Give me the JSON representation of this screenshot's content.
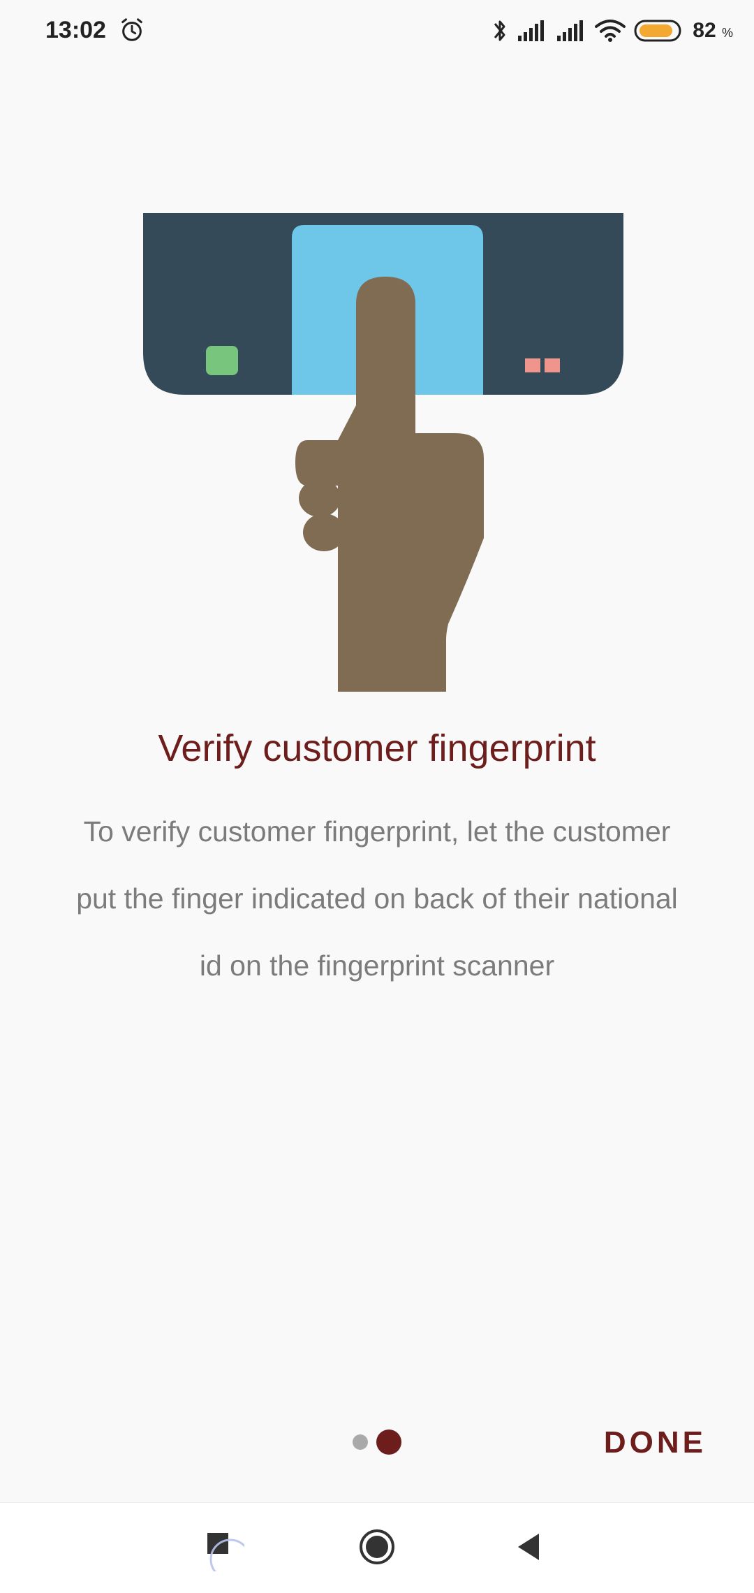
{
  "status_bar": {
    "time": "13:02",
    "battery_percent": "82",
    "battery_unit": "%",
    "icons": [
      "alarm-icon",
      "bluetooth-icon",
      "signal-icon",
      "signal-icon",
      "wifi-icon",
      "battery-icon"
    ]
  },
  "onboarding": {
    "title": "Verify customer fingerprint",
    "description": "To verify customer fingerprint, let the customer put the finger indicated on back of their national id on the fingerprint scanner",
    "page_count": 2,
    "current_page": 2
  },
  "actions": {
    "done_label": "DONE"
  },
  "colors": {
    "accent": "#6e1d1d",
    "scanner_body": "#354a59",
    "scanner_glass": "#6ec6e8",
    "hand": "#806c53",
    "led_green": "#78c67e",
    "led_red": "#f0958b"
  }
}
